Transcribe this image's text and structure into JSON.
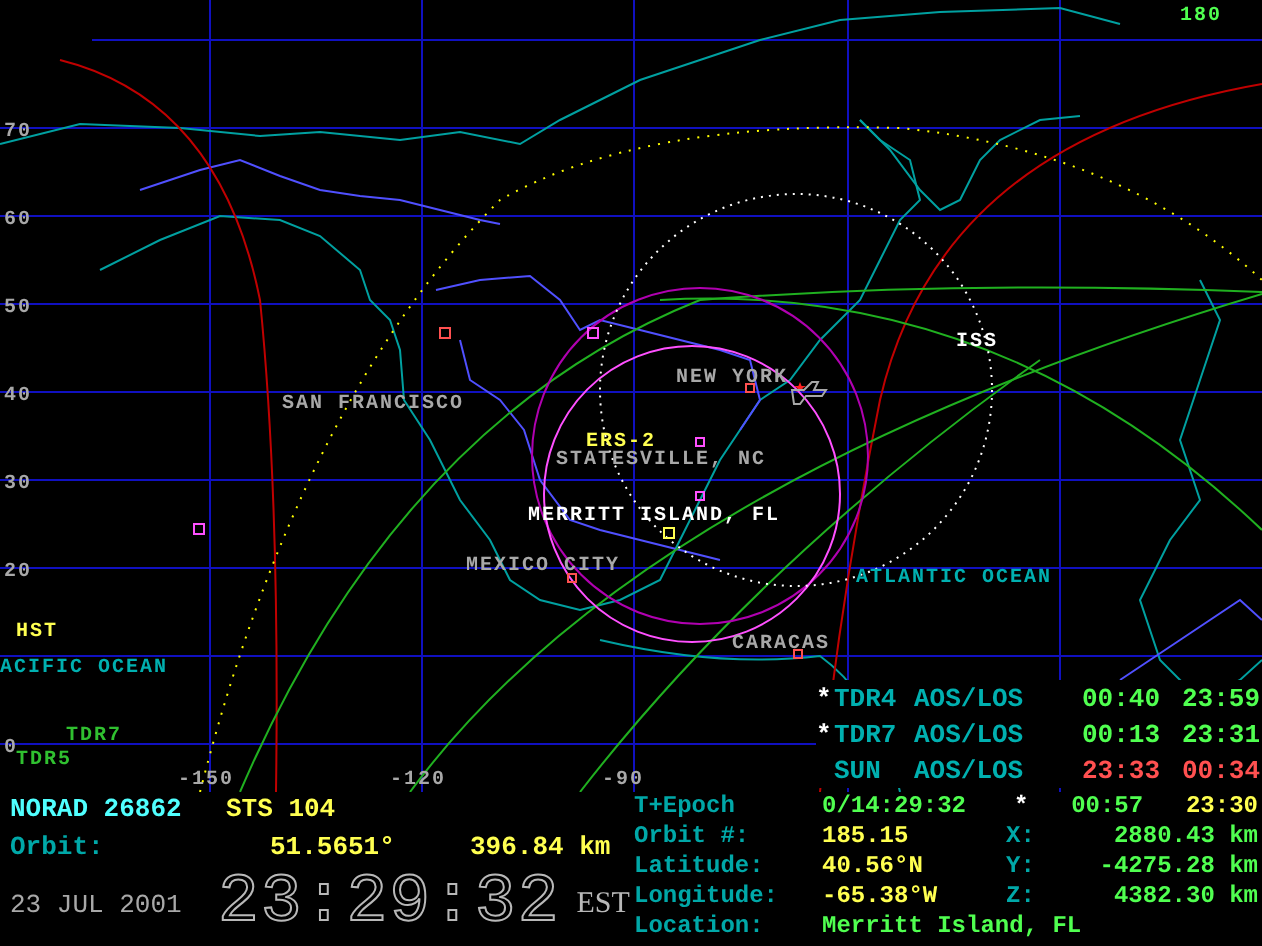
{
  "map": {
    "corner_label": "180",
    "latitude_labels": [
      "70",
      "60",
      "50",
      "40",
      "30",
      "20",
      "0"
    ],
    "longitude_labels": [
      "-150",
      "-120",
      "-90"
    ],
    "places": [
      {
        "label": "SAN FRANCISCO",
        "kind": "city"
      },
      {
        "label": "NEW YORK",
        "kind": "city"
      },
      {
        "label": "ERS-2",
        "kind": "satellite"
      },
      {
        "label": "STATESVILLE, NC",
        "kind": "city"
      },
      {
        "label": "MERRITT ISLAND, FL",
        "kind": "home"
      },
      {
        "label": "MEXICO CITY",
        "kind": "city"
      },
      {
        "label": "CARACAS",
        "kind": "city"
      },
      {
        "label": "ATLANTIC OCEAN",
        "kind": "ocean"
      },
      {
        "label": "ISS",
        "kind": "tracked"
      },
      {
        "label": "HST",
        "kind": "satellite"
      },
      {
        "label": "ACIFIC OCEAN",
        "kind": "ocean"
      },
      {
        "label": "TDR7",
        "kind": "relay"
      },
      {
        "label": "TDR5",
        "kind": "relay"
      }
    ]
  },
  "passes": [
    {
      "marker": "*",
      "name": "TDR4",
      "event": "AOS/LOS",
      "aos": "00:40",
      "los": "23:59",
      "color": "#50ff50"
    },
    {
      "marker": "*",
      "name": "TDR7",
      "event": "AOS/LOS",
      "aos": "00:13",
      "los": "23:31",
      "color": "#50ff50"
    },
    {
      "name": "SUN",
      "event": "AOS/LOS",
      "aos": "23:33",
      "los": "00:34",
      "color": "#ff5050"
    }
  ],
  "status": {
    "norad": "NORAD 26862",
    "mission": "STS 104",
    "orbit_label": "Orbit:",
    "inclination": "51.5651°",
    "altitude": "396.84 km",
    "date": "23 JUL 2001",
    "clock": "23:29:32",
    "zone": "EST",
    "rows": [
      {
        "label": "T+Epoch",
        "value": "0/14:29:32",
        "marker": "*",
        "axis": "00:57",
        "coord": "23:30"
      },
      {
        "label": "Orbit #:",
        "value": "185.15",
        "axis": "X:",
        "coord": "2880.43 km"
      },
      {
        "label": "Latitude:",
        "value": "40.56°N",
        "axis": "Y:",
        "coord": "-4275.28 km"
      },
      {
        "label": "Longitude:",
        "value": "-65.38°W",
        "axis": "Z:",
        "coord": "4382.30 km"
      },
      {
        "label": "Location:",
        "value": "Merritt Island, FL"
      }
    ]
  }
}
